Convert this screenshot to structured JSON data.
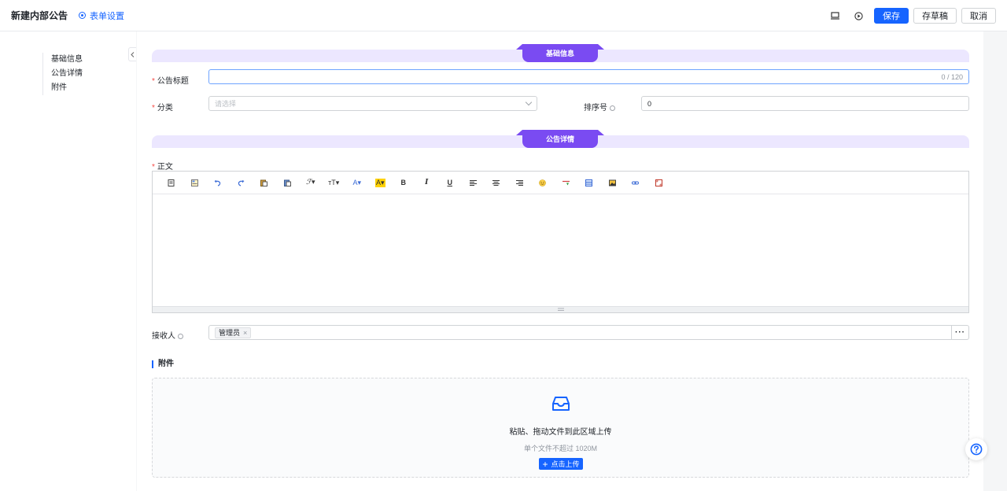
{
  "header": {
    "title": "新建内部公告",
    "form_settings": "表单设置",
    "save": "保存",
    "draft": "存草稿",
    "cancel": "取消"
  },
  "leftnav": {
    "items": [
      {
        "label": "基础信息"
      },
      {
        "label": "公告详情"
      },
      {
        "label": "附件"
      }
    ]
  },
  "sections": {
    "basic": "基础信息",
    "detail": "公告详情",
    "attachments": "附件"
  },
  "form": {
    "title_label": "公告标题",
    "title_value": "",
    "title_counter": "0 / 120",
    "category_label": "分类",
    "category_placeholder": "请选择",
    "sort_label": "排序号",
    "sort_value": "0",
    "body_label": "正文",
    "receiver_label": "接收人",
    "receiver_tag": "管理员",
    "receiver_tag_remove": "×",
    "more": "···"
  },
  "toolbar": {
    "items": [
      {
        "name": "source-icon",
        "text": ""
      },
      {
        "name": "template-icon",
        "text": ""
      },
      {
        "name": "undo-icon",
        "text": ""
      },
      {
        "name": "redo-icon",
        "text": ""
      },
      {
        "name": "paste-icon",
        "text": ""
      },
      {
        "name": "paste-text-icon",
        "text": ""
      },
      {
        "name": "font-family-icon",
        "text": "ℱ▾"
      },
      {
        "name": "font-size-icon",
        "text": "ᴛT▾"
      },
      {
        "name": "font-color-icon",
        "text": "A▾"
      },
      {
        "name": "highlight-icon",
        "text": "A▾"
      },
      {
        "name": "bold-icon",
        "text": "B"
      },
      {
        "name": "italic-icon",
        "text": "I"
      },
      {
        "name": "underline-icon",
        "text": "U"
      },
      {
        "name": "align-left-icon",
        "text": ""
      },
      {
        "name": "align-center-icon",
        "text": ""
      },
      {
        "name": "align-right-icon",
        "text": ""
      },
      {
        "name": "emoji-icon",
        "text": ""
      },
      {
        "name": "horizontal-rule-icon",
        "text": ""
      },
      {
        "name": "table-icon",
        "text": ""
      },
      {
        "name": "image-icon",
        "text": ""
      },
      {
        "name": "link-icon",
        "text": ""
      },
      {
        "name": "fullscreen-icon",
        "text": ""
      }
    ]
  },
  "upload": {
    "main_text": "粘贴、拖动文件到此区域上传",
    "sub_text": "单个文件不超过 1020M",
    "button_plus": "+",
    "button": "点击上传"
  },
  "colors": {
    "primary": "#1664ff",
    "section_tab": "#7a4bf2",
    "section_bar": "#ece7ff",
    "required": "#f54a45"
  }
}
